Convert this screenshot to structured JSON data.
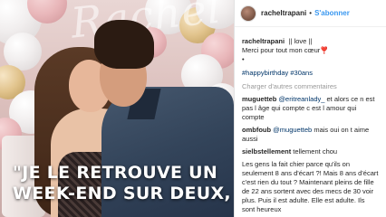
{
  "photo": {
    "background_text": "Rachel",
    "quote": "\"JE LE RETROUVE UN WEEK-END SUR DEUX,"
  },
  "post": {
    "header": {
      "username": "racheltrapani",
      "separator": "•",
      "follow_label": "S'abonner"
    },
    "caption": {
      "username": "racheltrapani",
      "text": "|| love ||",
      "line2": "Merci pour tout mon cœur❣️",
      "dots": "•",
      "hashtags": "#happybirthday #30ans"
    },
    "load_more": "Charger d'autres commentaires",
    "comments": [
      {
        "username": "muguetteb",
        "mention": "@eritreanlady_",
        "text": "et alors ce n est pas l âge qui compte c est l amour qui compte"
      },
      {
        "username": "ombfoub",
        "mention": "@muguetteb",
        "text": "mais oui on t aime aussi"
      },
      {
        "username": "sielbstellement",
        "mention": "",
        "text": "tellement chou"
      },
      {
        "username": "",
        "mention": "",
        "text": "Les gens la fait chier parce qu'ils on seulement 8 ans d'écart ?! Mais 8 ans d'écart c'est rien du tout ? Maintenant pleins de fille de 22 ans sortent avec des mecs de 30 voir plus. Puis il est adulte. Elle est adulte. Ils sont heureux"
      }
    ]
  }
}
